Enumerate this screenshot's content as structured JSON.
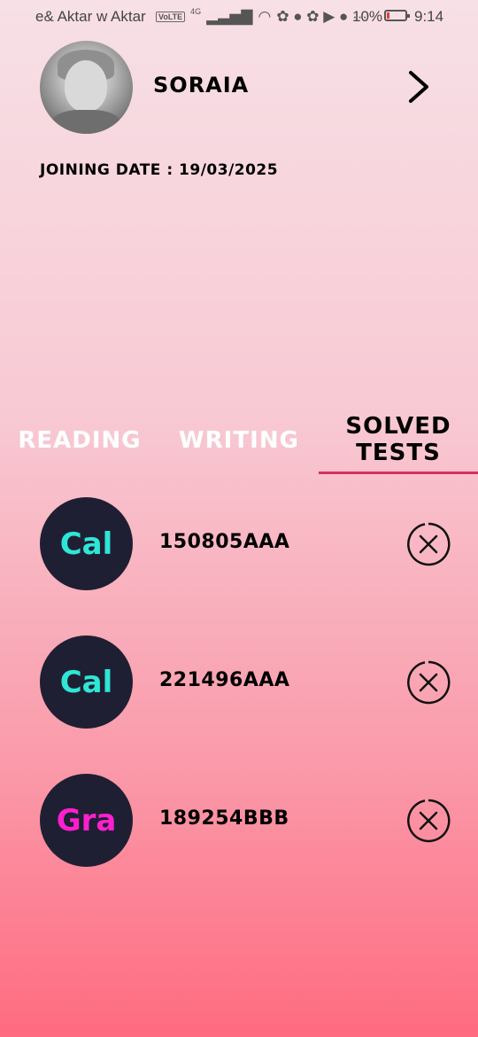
{
  "status_bar": {
    "carrier": "e& Aktar w Aktar",
    "volte": "VoLTE",
    "network": "4G",
    "battery_percent": "10%",
    "time": "9:14"
  },
  "profile": {
    "name": "SORAIA",
    "joining_date": "JOINING DATE : 19/03/2025"
  },
  "tabs": [
    {
      "label": "READING",
      "active": false
    },
    {
      "label": "WRITING",
      "active": false
    },
    {
      "label": "SOLVED TESTS",
      "active": true
    }
  ],
  "colors": {
    "accent_underline": "#d9305e",
    "badge_bg": "#1f1f33",
    "cal_text": "#2ee6d6",
    "gra_text": "#ff1fcf"
  },
  "solved_tests": [
    {
      "abbr": "Cal",
      "code": "150805AAA",
      "abbr_color": "#2ee6d6"
    },
    {
      "abbr": "Cal",
      "code": "221496AAA",
      "abbr_color": "#2ee6d6"
    },
    {
      "abbr": "Gra",
      "code": "189254BBB",
      "abbr_color": "#ff1fcf"
    }
  ]
}
